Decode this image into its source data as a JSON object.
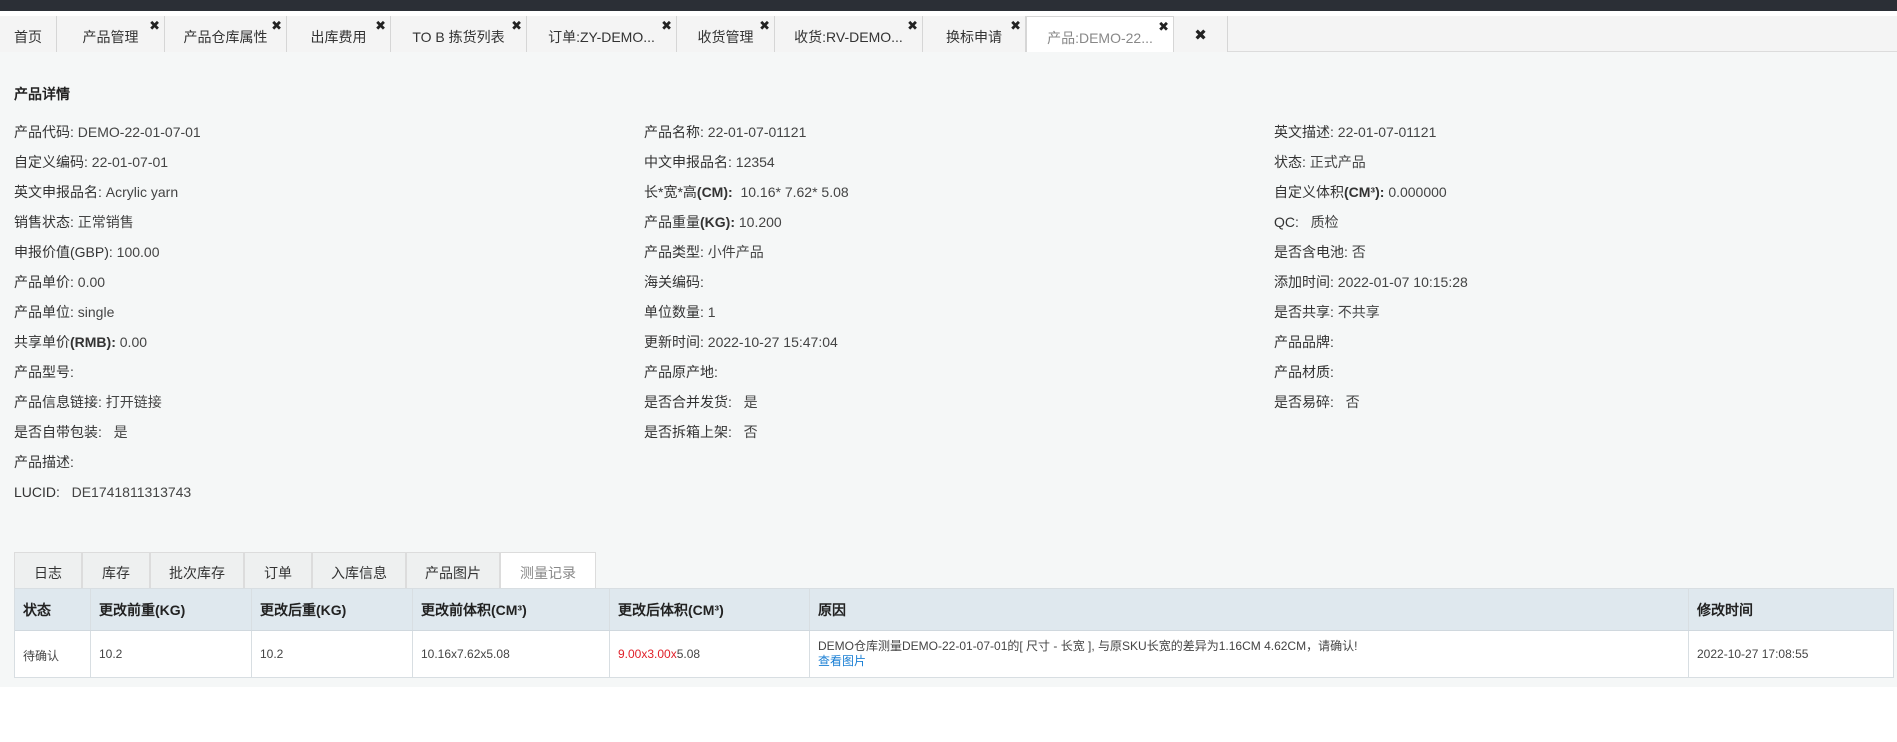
{
  "tabs": [
    {
      "label": "首页",
      "closable": false
    },
    {
      "label": "产品管理",
      "closable": true
    },
    {
      "label": "产品仓库属性",
      "closable": true
    },
    {
      "label": "出库费用",
      "closable": true
    },
    {
      "label": "TO B 拣货列表",
      "closable": true
    },
    {
      "label": "订单:ZY-DEMO...",
      "closable": true
    },
    {
      "label": "收货管理",
      "closable": true
    },
    {
      "label": "收货:RV-DEMO...",
      "closable": true
    },
    {
      "label": "换标申请",
      "closable": true
    },
    {
      "label": "产品:DEMO-22...",
      "closable": true,
      "active": true
    }
  ],
  "close_all_icon": "close-icon",
  "detail": {
    "title": "产品详情",
    "col1": [
      {
        "label": "产品代码:",
        "value": "DEMO-22-01-07-01"
      },
      {
        "label": "自定义编码:",
        "value": "22-01-07-01"
      },
      {
        "label": "英文申报品名:",
        "value": "Acrylic yarn"
      },
      {
        "label": "销售状态:",
        "value": "正常销售"
      },
      {
        "label": "申报价值(GBP):",
        "value": "100.00"
      },
      {
        "label": "产品单价:",
        "value": "0.00"
      },
      {
        "label": "产品单位:",
        "value": "single"
      },
      {
        "label": "共享单价",
        "label_bold": "(RMB):",
        "value": "0.00"
      },
      {
        "label": "产品型号:",
        "value": ""
      },
      {
        "label": "产品信息链接:",
        "value": "打开链接",
        "link": true
      },
      {
        "label": "是否自带包装:",
        "value": "是"
      },
      {
        "label": "产品描述:",
        "value": ""
      },
      {
        "label": "LUCID:",
        "value": "DE1741811313743"
      }
    ],
    "col2": [
      {
        "label": "产品名称:",
        "value": "22-01-07-01121"
      },
      {
        "label": "中文申报品名:",
        "value": "12354"
      },
      {
        "label": "长*宽*高",
        "label_bold": "(CM):",
        "value": "10.16* 7.62* 5.08"
      },
      {
        "label": "产品重量",
        "label_bold": "(KG):",
        "value": "10.200"
      },
      {
        "label": "产品类型:",
        "value": "小件产品"
      },
      {
        "label": "海关编码:",
        "value": ""
      },
      {
        "label": "单位数量:",
        "value": "1"
      },
      {
        "label": "更新时间:",
        "value": "2022-10-27 15:47:04"
      },
      {
        "label": "产品原产地:",
        "value": ""
      },
      {
        "label": "是否合并发货:",
        "value": "是"
      },
      {
        "label": "是否拆箱上架:",
        "value": "否"
      }
    ],
    "col3": [
      {
        "label": "英文描述:",
        "value": "22-01-07-01121"
      },
      {
        "label": "状态:",
        "value": "正式产品"
      },
      {
        "label": "自定义体积",
        "label_bold": "(CM³):",
        "value": "0.000000"
      },
      {
        "label": "QC:",
        "value": "质检"
      },
      {
        "label": "是否含电池:",
        "value": "否"
      },
      {
        "label": "添加时间:",
        "value": "2022-01-07 10:15:28"
      },
      {
        "label": "是否共享:",
        "value": "不共享"
      },
      {
        "label": "产品品牌:",
        "value": ""
      },
      {
        "label": "产品材质:",
        "value": ""
      },
      {
        "label": "是否易碎:",
        "value": "否"
      }
    ]
  },
  "subtabs": [
    {
      "label": "日志"
    },
    {
      "label": "库存"
    },
    {
      "label": "批次库存"
    },
    {
      "label": "订单"
    },
    {
      "label": "入库信息"
    },
    {
      "label": "产品图片"
    },
    {
      "label": "测量记录",
      "active": true
    }
  ],
  "table": {
    "headers": [
      "状态",
      "更改前重(KG)",
      "更改后重(KG)",
      "更改前体积(CM³)",
      "更改后体积(CM³)",
      "原因",
      "修改时间"
    ],
    "rows": [
      {
        "status": "待确认",
        "weight_before": "10.2",
        "weight_after": "10.2",
        "volume_before": "10.16x7.62x5.08",
        "volume_after_changed": "9.00x3.00x",
        "volume_after_rest": "5.08",
        "reason": "DEMO仓库测量DEMO-22-01-07-01的[ 尺寸 - 长宽 ], 与原SKU长宽的差异为1.16CM 4.62CM，请确认!",
        "reason_link": "查看图片",
        "time": "2022-10-27 17:08:55"
      }
    ]
  },
  "colors": {
    "link": "#1a7fd4",
    "changed_value": "#e0212a",
    "header_bg": "#dfe8ee"
  }
}
